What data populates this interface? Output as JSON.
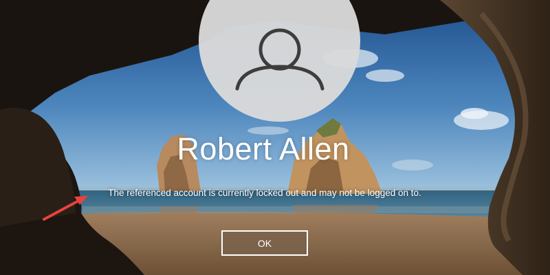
{
  "user": {
    "name": "Robert Allen",
    "avatar_icon": "user-silhouette-icon"
  },
  "dialog": {
    "message": "The referenced account is currently locked out and may not be logged on to.",
    "ok_label": "OK"
  },
  "annotation": {
    "arrow_color": "#e8433e"
  },
  "colors": {
    "text": "#ffffff",
    "avatar_bg": "#dadada",
    "avatar_icon": "#3d3d3d"
  }
}
